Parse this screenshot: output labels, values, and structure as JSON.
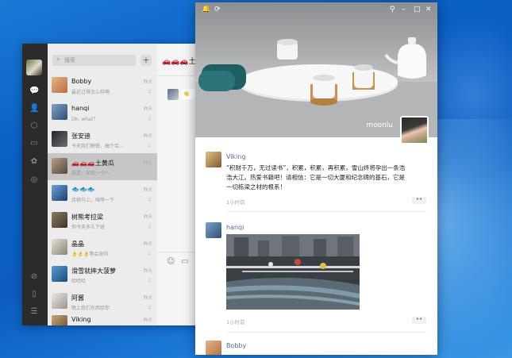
{
  "wechat": {
    "search_placeholder": "搜索",
    "add_label": "+",
    "chats": [
      {
        "name": "Bobby",
        "preview": "最近过得怎么样啊",
        "time": "昨天",
        "avatar": "#d9a070"
      },
      {
        "name": "hanqi",
        "preview": "Oh, what？",
        "time": "昨天",
        "avatar": "#5b7fa8"
      },
      {
        "name": "张安迪",
        "preview": "今天我们野餐，搞个合…",
        "time": "昨天",
        "avatar": "#3a3f4a"
      },
      {
        "name": "🚗🚗🚗土黄瓜",
        "preview": "晨昱：加我一个～",
        "time": "昨天",
        "avatar": "#8a7a6c"
      },
      {
        "name": "🐟🐟🐟",
        "preview": "月桃马上，嗨等一下",
        "time": "昨天",
        "avatar": "#4a78b8"
      },
      {
        "name": "树熊考拉梁",
        "preview": "你今天多久下班",
        "time": "昨天",
        "avatar": "#6b5c4c"
      },
      {
        "name": "晶晶",
        "preview": "👌👌👌等会发你",
        "time": "昨天",
        "avatar": "#c8c0b0"
      },
      {
        "name": "滑雪就摔大菠萝",
        "preview": "哈哈哈",
        "time": "昨天",
        "avatar": "#2f6fa8"
      },
      {
        "name": "阿酱",
        "preview": "晚上我们东西给你",
        "time": "昨天",
        "avatar": "#d4d0cb"
      },
      {
        "name": "Viking",
        "preview": "",
        "time": "昨天",
        "avatar": "#9a7b52"
      }
    ],
    "chat_title": "🚗🚗🚗土黄瓜",
    "chat_bubble": "👋"
  },
  "moments": {
    "cover_name": "moonlu",
    "posts": [
      {
        "name": "Viking",
        "text": "“积财千万，无过读书”，积累，积累，再积累，雪山终将孕出一条浩浩大江。热爱书籍吧！请相信：它是一切大厦和纪念碑的基石，它是一切栋梁之材的根系！",
        "time": "1小时前",
        "avatar": "#9a7b52"
      },
      {
        "name": "hanqi",
        "text": "",
        "time": "1小时前",
        "avatar": "#5b7fa8"
      },
      {
        "name": "Bobby",
        "text": "",
        "time": "",
        "avatar": "#d9a070"
      }
    ],
    "more_label": "••"
  },
  "colors": {
    "link": "#576b95",
    "wechat_green": "#2bc160",
    "rail": "#2b2b2b"
  }
}
